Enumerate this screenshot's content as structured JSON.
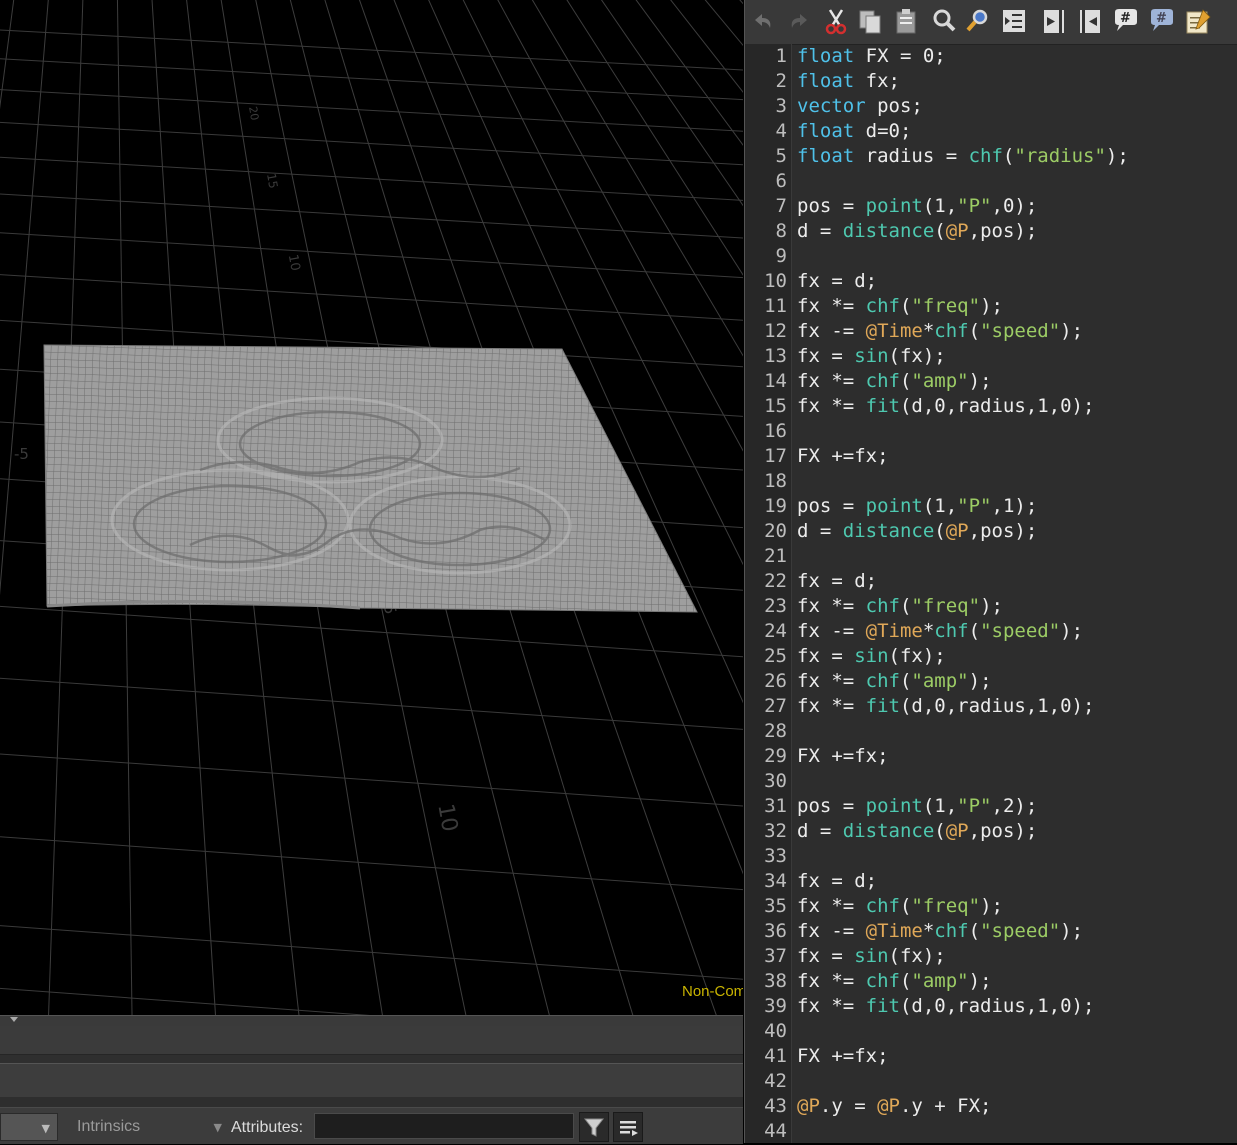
{
  "viewport": {
    "grid_labels": [
      "-5",
      "-5",
      "0",
      "5",
      "10",
      "10",
      "15",
      "20"
    ],
    "status_text": "Non-Com"
  },
  "bottom_bar": {
    "intrinsics_label": "Intrinsics",
    "attributes_label": "Attributes:",
    "attributes_value": ""
  },
  "toolbar": {
    "icons": [
      "undo-icon",
      "redo-icon",
      "cut-icon",
      "copy-icon",
      "paste-icon",
      "find-icon",
      "find-replace-icon",
      "indent-icon",
      "step-in-icon",
      "step-out-icon",
      "comment-icon",
      "uncomment-icon",
      "notes-icon"
    ]
  },
  "colors": {
    "keyword": "#4fc1e9",
    "function": "#4ec9b0",
    "string": "#9ccc65",
    "attribute": "#e0a858",
    "text": "#ececec",
    "line_number": "#bdbdbd",
    "status": "#c9b400"
  },
  "code": [
    "float FX = 0;",
    "float fx;",
    "vector pos;",
    "float d=0;",
    "float radius = chf(\"radius\");",
    "",
    "pos = point(1,\"P\",0);",
    "d = distance(@P,pos);",
    "",
    "fx = d;",
    "fx *= chf(\"freq\");",
    "fx -= @Time*chf(\"speed\");",
    "fx = sin(fx);",
    "fx *= chf(\"amp\");",
    "fx *= fit(d,0,radius,1,0);",
    "",
    "FX +=fx;",
    "",
    "pos = point(1,\"P\",1);",
    "d = distance(@P,pos);",
    "",
    "fx = d;",
    "fx *= chf(\"freq\");",
    "fx -= @Time*chf(\"speed\");",
    "fx = sin(fx);",
    "fx *= chf(\"amp\");",
    "fx *= fit(d,0,radius,1,0);",
    "",
    "FX +=fx;",
    "",
    "pos = point(1,\"P\",2);",
    "d = distance(@P,pos);",
    "",
    "fx = d;",
    "fx *= chf(\"freq\");",
    "fx -= @Time*chf(\"speed\");",
    "fx = sin(fx);",
    "fx *= chf(\"amp\");",
    "fx *= fit(d,0,radius,1,0);",
    "",
    "FX +=fx;",
    "",
    "@P.y = @P.y + FX;",
    ""
  ]
}
